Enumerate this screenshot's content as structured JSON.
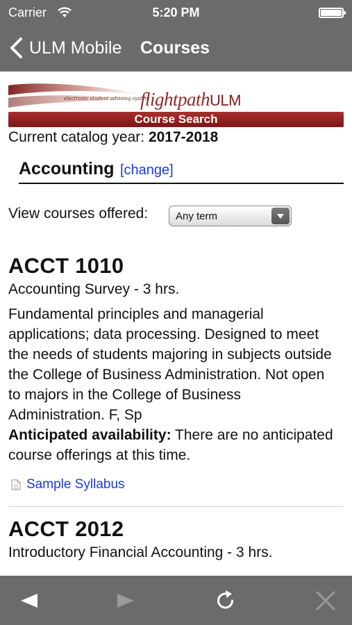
{
  "status": {
    "carrier": "Carrier",
    "time": "5:20 PM"
  },
  "nav": {
    "back_label": "ULM Mobile",
    "title": "Courses"
  },
  "logo": {
    "tagline": "electronic student advising system",
    "brand_italic": "flightpath",
    "brand_suffix": "ULM"
  },
  "search_bar": "Course Search",
  "catalog": {
    "label": "Current catalog year: ",
    "year": "2017-2018"
  },
  "department": {
    "name": "Accounting",
    "change_link": "[change]"
  },
  "filter": {
    "label": "View courses offered:",
    "selected": "Any term"
  },
  "courses": [
    {
      "code": "ACCT 1010",
      "title": "Accounting Survey - 3 hrs.",
      "description": "Fundamental principles and managerial applications; data processing. Designed to meet the needs of students majoring in subjects outside the College of Business Administration. Not open to majors in the College of Business Administration. F, Sp",
      "availability_label": "Anticipated availability:",
      "availability_text": " There are no anticipated course offerings at this time.",
      "syllabus_link": "Sample Syllabus"
    },
    {
      "code": "ACCT 2012",
      "title": "Introductory Financial Accounting - 3 hrs."
    }
  ],
  "icons": {
    "back": "chevron-left-icon",
    "wifi": "wifi-icon",
    "battery": "battery-icon",
    "doc": "document-icon",
    "toolbar": [
      "back-arrow-icon",
      "forward-arrow-icon",
      "reload-icon",
      "close-icon"
    ]
  },
  "colors": {
    "bar_gray": "#6b6b6b",
    "brand_red": "#8c2a2a",
    "link_blue": "#1a3bd6"
  }
}
